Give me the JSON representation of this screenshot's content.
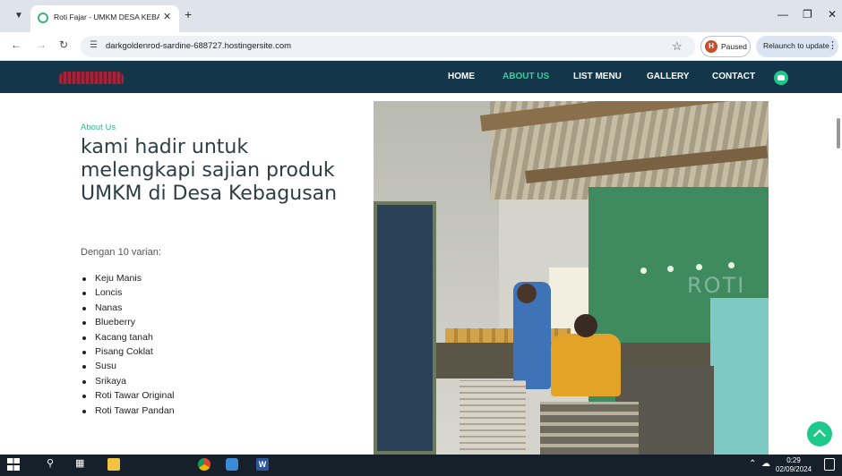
{
  "browser": {
    "tab_title": "Roti Fajar - UMKM DESA KEBAG",
    "url": "darkgoldenrod-sardine-688727.hostingersite.com",
    "profile_initial": "H",
    "profile_status": "Paused",
    "relaunch_label": "Relaunch to update",
    "icons": {
      "tab_menu": "chevron-down-icon",
      "new_tab": "plus-icon",
      "back": "arrow-left-icon",
      "forward": "arrow-right-icon",
      "reload": "reload-icon",
      "site_info": "tune-icon",
      "bookmark": "star-icon"
    }
  },
  "nav": {
    "items": [
      {
        "label": "HOME",
        "active": false
      },
      {
        "label": "ABOUT US",
        "active": true
      },
      {
        "label": "LIST MENU",
        "active": false
      },
      {
        "label": "GALLERY",
        "active": false
      },
      {
        "label": "CONTACT",
        "active": false
      }
    ],
    "accent_color": "#2fd39a",
    "bar_color": "#13364a"
  },
  "about": {
    "label": "About Us",
    "headline": "kami hadir untuk melengkapi sajian produk UMKM di Desa Kebagusan",
    "variant_intro": "Dengan 10 varian:",
    "variants": [
      "Keju Manis",
      "Loncis",
      "Nanas",
      "Blueberry",
      "Kacang tanah",
      "Pisang Coklat",
      "Susu",
      "Srikaya",
      "Roti Tawar Original",
      "Roti Tawar Pandan"
    ]
  },
  "photo": {
    "wall_text": "ROTI"
  },
  "taskbar": {
    "time": "0:29",
    "date": "02/09/2024"
  }
}
